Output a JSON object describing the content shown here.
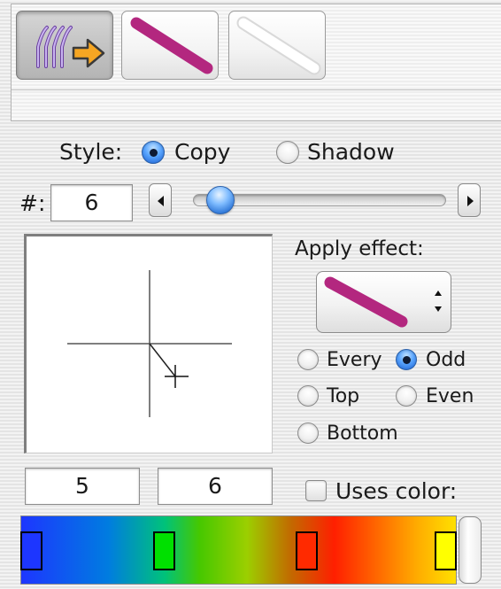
{
  "toolbar": {
    "buttons": [
      {
        "icon": "copy-arrow-icon",
        "selected": true
      },
      {
        "icon": "magenta-stroke-icon",
        "selected": false
      },
      {
        "icon": "white-stroke-icon",
        "selected": false
      }
    ]
  },
  "style": {
    "label": "Style:",
    "options": [
      {
        "label": "Copy",
        "selected": true
      },
      {
        "label": "Shadow",
        "selected": false
      }
    ]
  },
  "count": {
    "label": "#:",
    "value": "6",
    "slider_fraction": 0.06
  },
  "offset": {
    "x": "5",
    "y": "6"
  },
  "apply_effect": {
    "label": "Apply effect:",
    "selected_icon": "magenta-stroke-icon",
    "options": [
      {
        "label": "Every",
        "selected": false
      },
      {
        "label": "Odd",
        "selected": true
      },
      {
        "label": "Top",
        "selected": false
      },
      {
        "label": "Even",
        "selected": false
      },
      {
        "label": "Bottom",
        "selected": false
      }
    ]
  },
  "uses_color": {
    "label": "Uses color:",
    "checked": false
  },
  "colors": {
    "accent_magenta": "#b3277f",
    "radio_blue": "#2f7cf0",
    "gradient_stops": [
      "#1d36ff",
      "#00e000",
      "#ff2a00",
      "#ffff00"
    ]
  }
}
